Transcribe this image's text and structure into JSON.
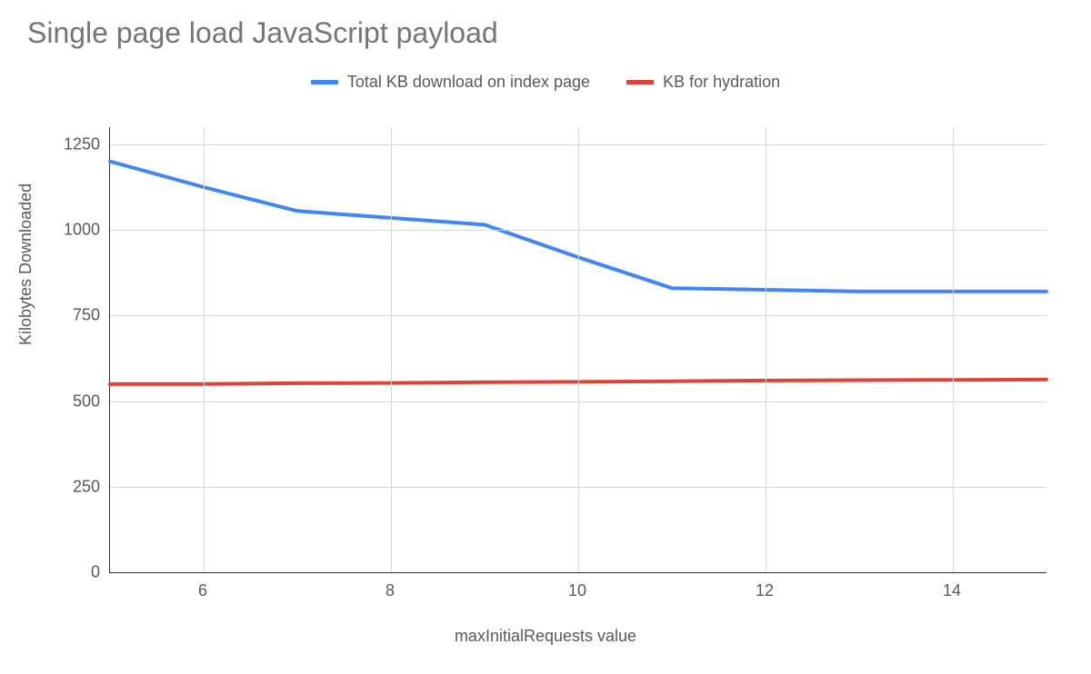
{
  "title": "Single page load JavaScript payload",
  "legend": {
    "series1": "Total KB download on index page",
    "series2": "KB for hydration"
  },
  "ylabel": "Kilobytes Downloaded",
  "xlabel": "maxInitialRequests value",
  "colors": {
    "series1": "#4285f4",
    "series2": "#db4437"
  },
  "chart_data": {
    "type": "line",
    "x": [
      5,
      6,
      7,
      8,
      9,
      10,
      11,
      12,
      13,
      14,
      15
    ],
    "series": [
      {
        "name": "Total KB download on index page",
        "values": [
          1200,
          1125,
          1055,
          1035,
          1015,
          920,
          830,
          825,
          820,
          820,
          820
        ]
      },
      {
        "name": "KB for hydration",
        "values": [
          550,
          550,
          552,
          553,
          555,
          556,
          558,
          560,
          561,
          562,
          563
        ]
      }
    ],
    "xlim": [
      5,
      15
    ],
    "ylim": [
      0,
      1300
    ],
    "xticks": [
      6,
      8,
      10,
      12,
      14
    ],
    "yticks": [
      0,
      250,
      500,
      750,
      1000,
      1250
    ],
    "grid": true
  }
}
